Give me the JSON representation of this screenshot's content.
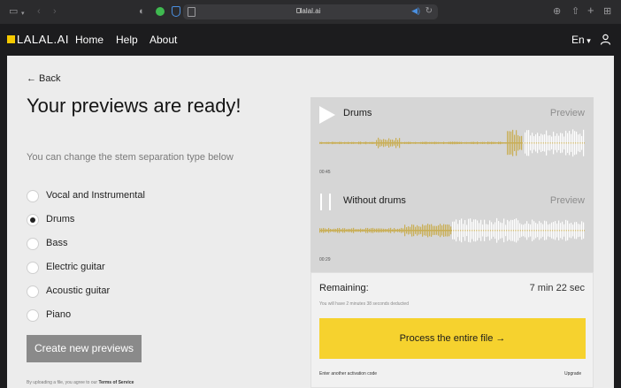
{
  "browser": {
    "url": "lalal.ai",
    "icons": [
      "sidebar-icon",
      "chevron-down-icon",
      "back-arrow-icon",
      "forward-arrow-icon",
      "shield-icon",
      "extension-icon",
      "vpn-icon",
      "page-icon",
      "lock-icon",
      "sound-icon",
      "reload-icon",
      "download-icon",
      "share-icon",
      "new-tab-icon",
      "tab-overview-icon"
    ]
  },
  "nav": {
    "logo": "LALAL.AI",
    "links": [
      "Home",
      "Help",
      "About"
    ],
    "language": "En"
  },
  "main": {
    "back": "← Back",
    "title": "Your previews are ready!",
    "subtitle": "You can change the stem separation type below",
    "options": [
      {
        "label": "Vocal and Instrumental",
        "selected": false
      },
      {
        "label": "Drums",
        "selected": true
      },
      {
        "label": "Bass",
        "selected": false
      },
      {
        "label": "Electric guitar",
        "selected": false
      },
      {
        "label": "Acoustic guitar",
        "selected": false
      },
      {
        "label": "Piano",
        "selected": false
      }
    ],
    "create_button": "Create new previews",
    "tos_prefix": "By uploading a file, you agree to our",
    "tos_link": "Terms of Service"
  },
  "previews": [
    {
      "name": "Drums",
      "preview_label": "Preview",
      "time": "00:45",
      "state": "paused"
    },
    {
      "name": "Without drums",
      "preview_label": "Preview",
      "time": "00:29",
      "state": "playing"
    }
  ],
  "colors": {
    "accent": "#f6d22e",
    "wave_played": "#c9ae55",
    "wave_unplayed": "#ffffff",
    "card_bg": "#d6d6d6"
  },
  "remaining": {
    "label": "Remaining:",
    "value": "7 min 22 sec",
    "note": "You will have 2 minutes 38 seconds deducted",
    "process_button": "Process the entire file →",
    "activation_link": "Enter another activation code",
    "upgrade_link": "Upgrade"
  }
}
